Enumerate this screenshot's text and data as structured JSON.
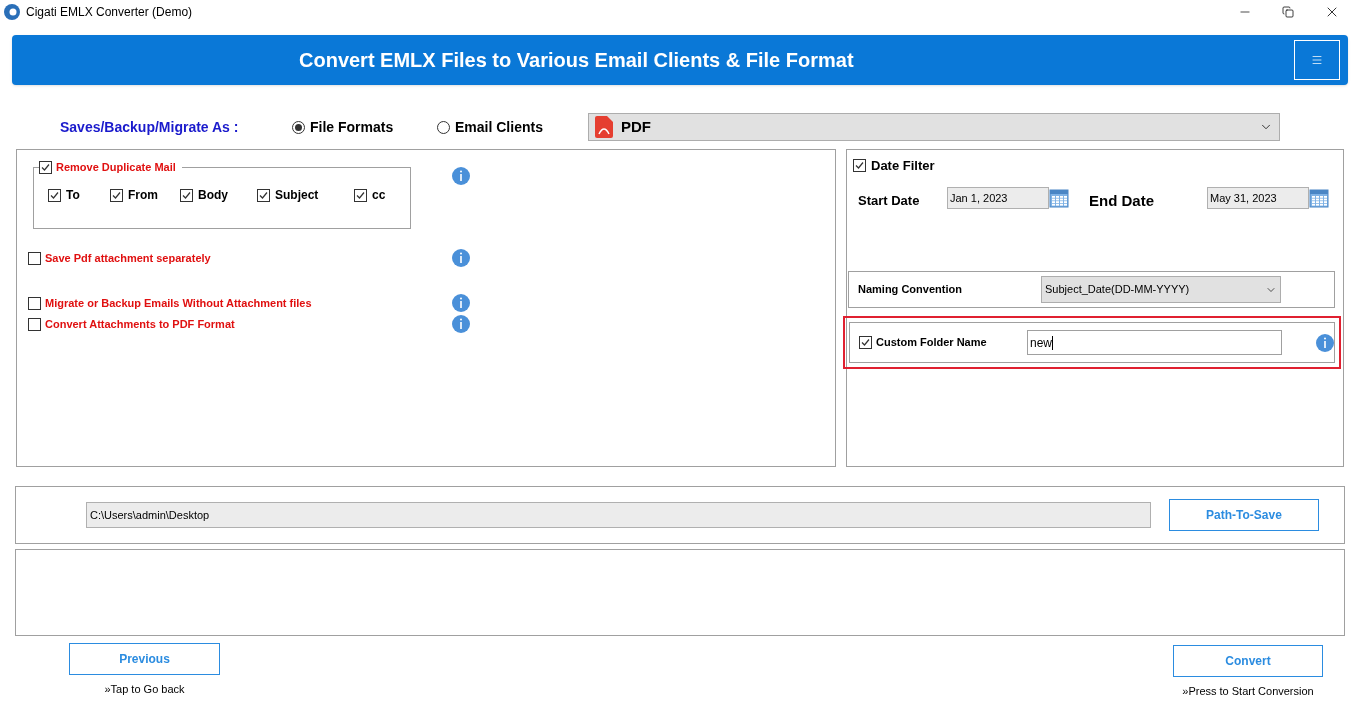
{
  "window": {
    "title": "Cigati EMLX Converter (Demo)"
  },
  "banner": {
    "title": "Convert EMLX Files to Various Email Clients & File Format"
  },
  "save_as": {
    "label": "Saves/Backup/Migrate As :",
    "options": [
      {
        "label": "File Formats",
        "selected": true
      },
      {
        "label": "Email Clients",
        "selected": false
      }
    ],
    "format": "PDF"
  },
  "remove_duplicate": {
    "label": "Remove Duplicate Mail",
    "checked": true,
    "fields": [
      {
        "label": "To",
        "checked": true
      },
      {
        "label": "From",
        "checked": true
      },
      {
        "label": "Body",
        "checked": true
      },
      {
        "label": "Subject",
        "checked": true
      },
      {
        "label": "cc",
        "checked": true
      }
    ]
  },
  "options": [
    {
      "label": "Save Pdf attachment separately",
      "checked": false
    },
    {
      "label": "Migrate or Backup Emails Without Attachment files",
      "checked": false
    },
    {
      "label": "Convert Attachments to PDF Format",
      "checked": false
    }
  ],
  "date_filter": {
    "label": "Date Filter",
    "checked": true,
    "start_label": "Start Date",
    "start": "Jan 1, 2023",
    "end_label": "End Date",
    "end": "May 31, 2023"
  },
  "naming": {
    "label": "Naming Convention",
    "value": "Subject_Date(DD-MM-YYYY)"
  },
  "custom_folder": {
    "label": "Custom Folder Name",
    "checked": true,
    "value": "new"
  },
  "path": {
    "value": "C:\\Users\\admin\\Desktop",
    "button": "Path-To-Save"
  },
  "nav": [
    {
      "button": "Previous",
      "hint": "»Tap to Go back"
    },
    {
      "button": "Convert",
      "hint": "»Press to Start Conversion"
    }
  ]
}
